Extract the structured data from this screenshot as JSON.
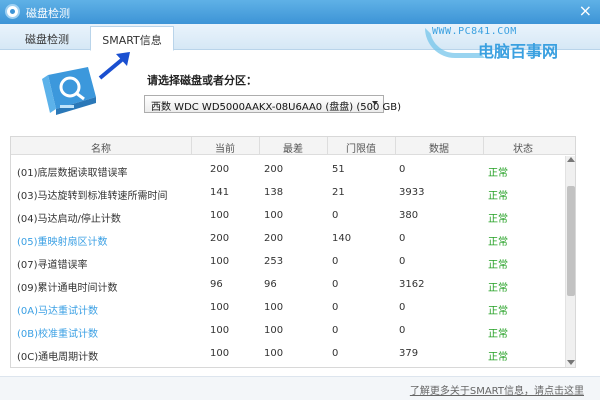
{
  "window": {
    "title": "磁盘检测",
    "close_label": "×"
  },
  "tabs": [
    {
      "label": "磁盘检测"
    },
    {
      "label": "SMART信息"
    }
  ],
  "watermark": {
    "url": "WWW.PC841.COM",
    "name": "电脑百事网"
  },
  "disk_picker": {
    "label": "请选择磁盘或者分区：",
    "selected": "西数 WDC WD5000AAKX-08U6AA0 (盘盘) (500 GB)"
  },
  "table": {
    "headers": [
      "名称",
      "当前",
      "最差",
      "门限值",
      "数据",
      "状态"
    ],
    "rows": [
      {
        "name": "(01)底层数据读取错误率",
        "current": "200",
        "worst": "200",
        "threshold": "51",
        "data": "0",
        "status": "正常",
        "warn": false
      },
      {
        "name": "(03)马达旋转到标准转速所需时间",
        "current": "141",
        "worst": "138",
        "threshold": "21",
        "data": "3933",
        "status": "正常",
        "warn": false
      },
      {
        "name": "(04)马达启动/停止计数",
        "current": "100",
        "worst": "100",
        "threshold": "0",
        "data": "380",
        "status": "正常",
        "warn": false
      },
      {
        "name": "(05)重映射扇区计数",
        "current": "200",
        "worst": "200",
        "threshold": "140",
        "data": "0",
        "status": "正常",
        "warn": true
      },
      {
        "name": "(07)寻道错误率",
        "current": "100",
        "worst": "253",
        "threshold": "0",
        "data": "0",
        "status": "正常",
        "warn": false
      },
      {
        "name": "(09)累计通电时间计数",
        "current": "96",
        "worst": "96",
        "threshold": "0",
        "data": "3162",
        "status": "正常",
        "warn": false
      },
      {
        "name": "(0A)马达重试计数",
        "current": "100",
        "worst": "100",
        "threshold": "0",
        "data": "0",
        "status": "正常",
        "warn": true
      },
      {
        "name": "(0B)校准重试计数",
        "current": "100",
        "worst": "100",
        "threshold": "0",
        "data": "0",
        "status": "正常",
        "warn": true
      },
      {
        "name": "(0C)通电周期计数",
        "current": "100",
        "worst": "100",
        "threshold": "0",
        "data": "379",
        "status": "正常",
        "warn": false
      }
    ]
  },
  "footer": {
    "link": "了解更多关于SMART信息，请点击这里"
  },
  "colors": {
    "accent": "#3d94d6",
    "status_ok": "#23a023",
    "warn_text": "#3ba0e4"
  }
}
